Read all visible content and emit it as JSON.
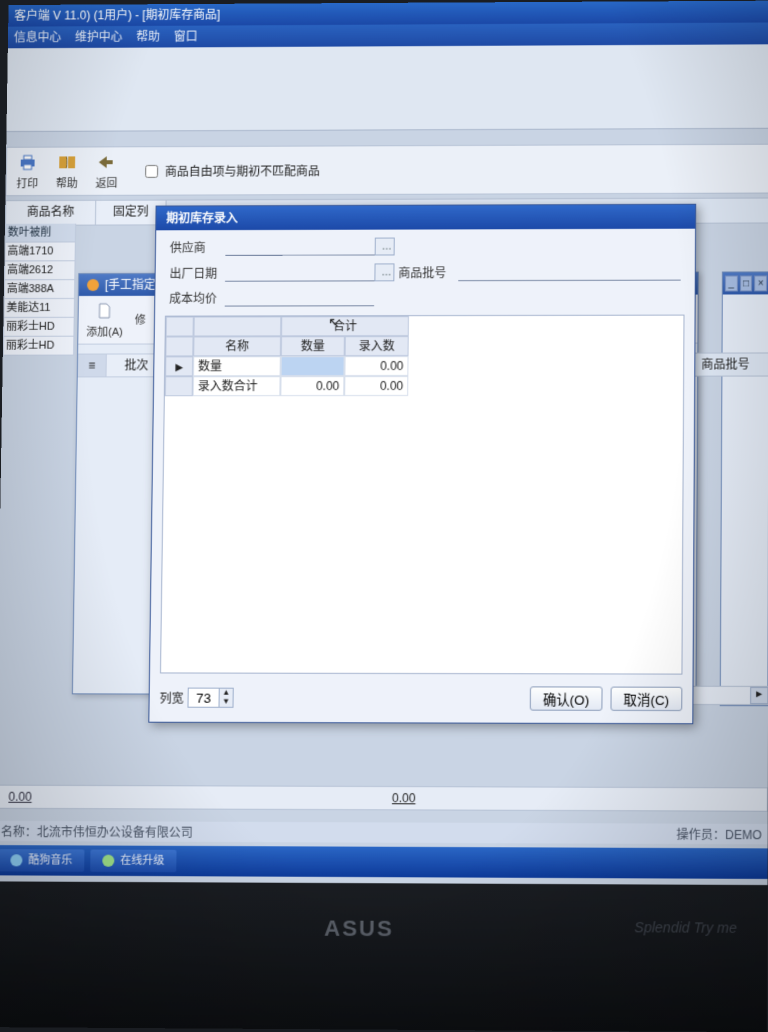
{
  "main": {
    "title": "客户端 V 11.0) (1用户) - [期初库存商品]",
    "menu": [
      "信息中心",
      "维护中心",
      "帮助",
      "窗口"
    ]
  },
  "toolbar": {
    "print": "打印",
    "help": "帮助",
    "back": "返回",
    "checkbox_label": "商品自由项与期初不匹配商品"
  },
  "headers": {
    "fixed_col": "固定列",
    "product_name": "商品名称",
    "product_batch": "商品批号",
    "batch": "批次"
  },
  "bg_list": {
    "header": "数叶被削",
    "items": [
      "高端1710",
      "高端2612",
      "高端388A",
      "美能达11",
      "丽彩士HD",
      "丽彩士HD"
    ]
  },
  "mid_window": {
    "title": "[手工指定]",
    "add": "添加(A)",
    "edit": "修"
  },
  "dialog": {
    "title": "期初库存录入",
    "labels": {
      "supplier": "供应商",
      "out_date": "出厂日期",
      "batch_no": "商品批号",
      "avg_cost": "成本均价"
    },
    "supplier_value": "",
    "out_date_value": "",
    "batch_no_value": "",
    "avg_cost_value": "",
    "grid": {
      "merged_header": "合计",
      "cols": {
        "name": "名称",
        "qty": "数量",
        "entered": "录入数"
      },
      "rows": [
        {
          "name": "数量",
          "qty": "",
          "entered": "0.00"
        },
        {
          "name": "录入数合计",
          "qty": "0.00",
          "entered": "0.00"
        }
      ]
    },
    "footer": {
      "col_width_label": "列宽",
      "col_width_value": "73",
      "ok": "确认(O)",
      "cancel": "取消(C)"
    }
  },
  "bottom": {
    "left": "0.00",
    "mid": "0.00"
  },
  "status": {
    "left": "名称：北流市伟恒办公设备有限公司",
    "right": "操作员：DEMO"
  },
  "taskbar": {
    "items": [
      "酷狗音乐",
      "在线升级"
    ]
  },
  "monitor": {
    "brand": "ASUS",
    "tagline": "Splendid Try me"
  }
}
